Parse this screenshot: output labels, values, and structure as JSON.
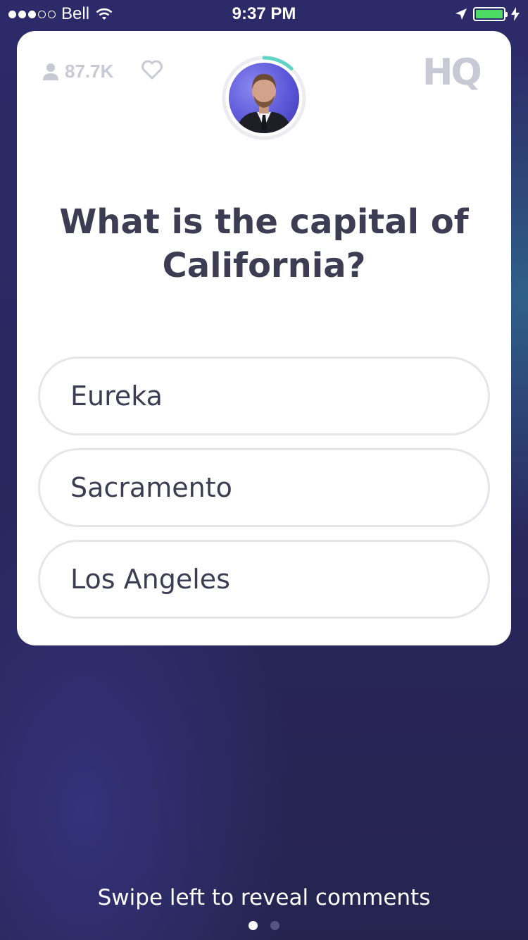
{
  "status_bar": {
    "carrier": "Bell",
    "time": "9:37 PM",
    "signal_bars_filled": 3,
    "signal_bars_total": 5,
    "battery_level": 1.0,
    "battery_color": "#4cd964"
  },
  "card": {
    "viewer_count": "87.7K",
    "logo": "HQ",
    "timer_accent_color": "#5fd4c7",
    "timer_progress": 0.12,
    "question": "What is the capital of California?",
    "answers": [
      {
        "label": "Eureka"
      },
      {
        "label": "Sacramento"
      },
      {
        "label": "Los Angeles"
      }
    ]
  },
  "footer": {
    "swipe_hint": "Swipe left to reveal comments",
    "page_index": 0,
    "page_count": 2
  },
  "icons": [
    "signal-icon",
    "wifi-icon",
    "location-arrow-icon",
    "battery-icon",
    "charging-bolt-icon",
    "person-icon",
    "heart-icon"
  ]
}
